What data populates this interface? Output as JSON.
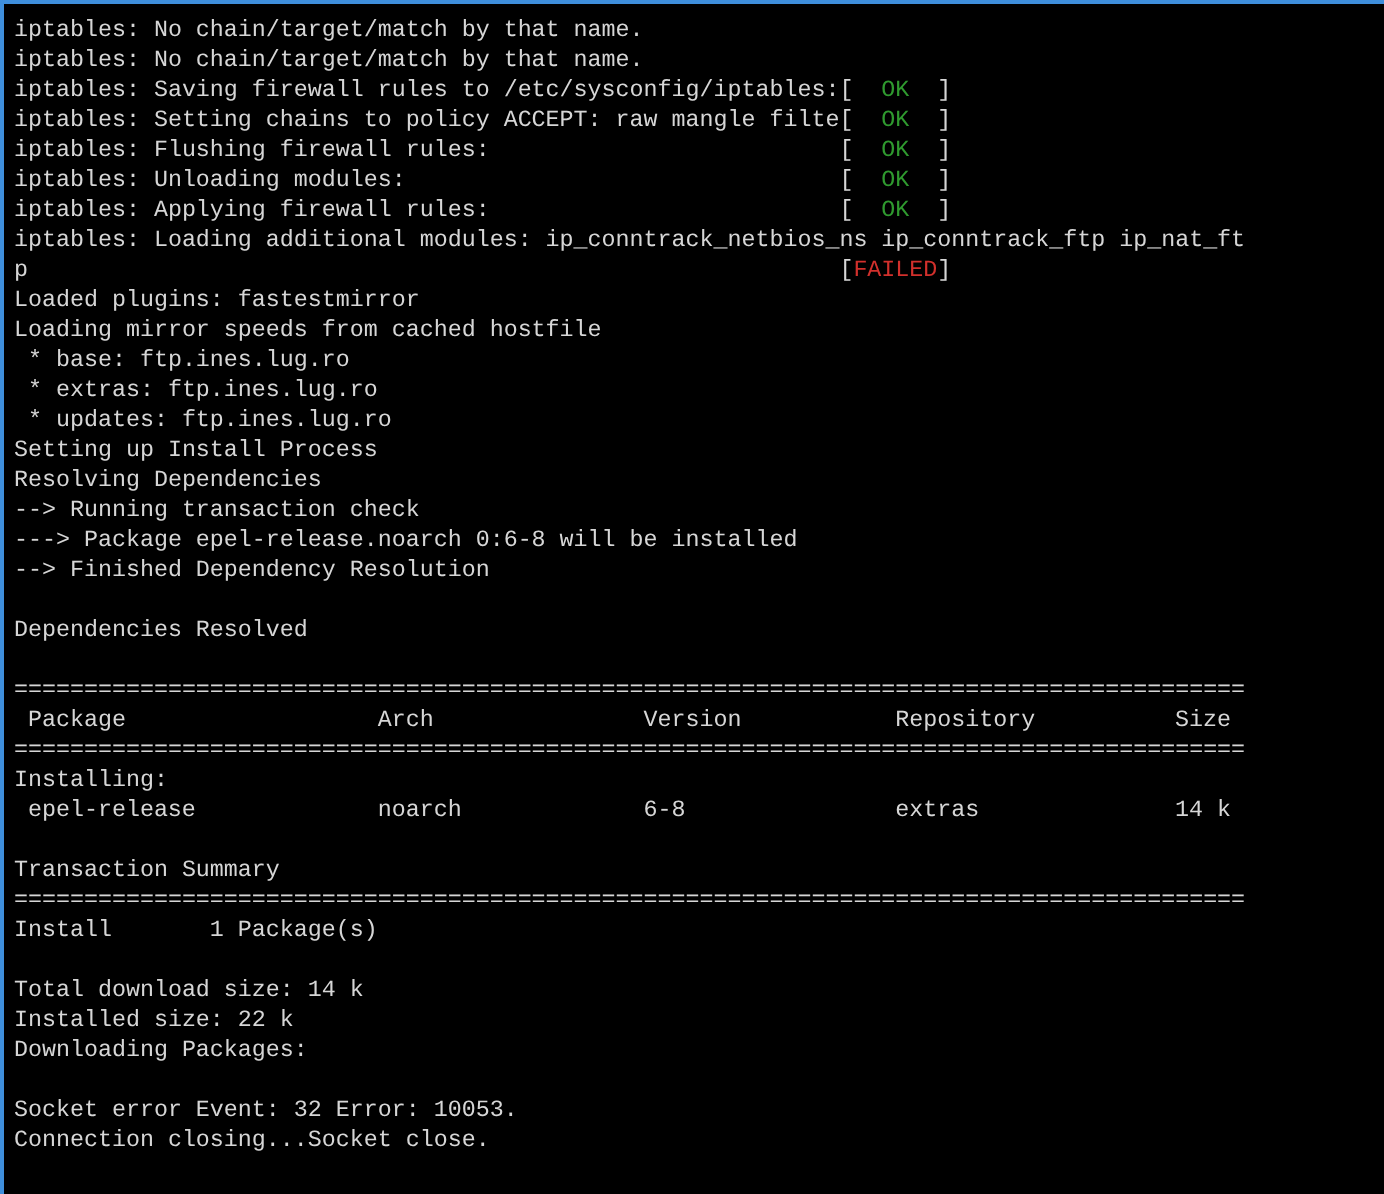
{
  "terminal": {
    "lines": [
      {
        "kind": "text",
        "text": "iptables: No chain/target/match by that name."
      },
      {
        "kind": "text",
        "text": "iptables: No chain/target/match by that name."
      },
      {
        "kind": "text",
        "text": "iptables: Saving firewall rules to /etc/sysconfig/iptables:",
        "status": {
          "open": "[",
          "label": "OK",
          "close": "]",
          "kind": "ok"
        }
      },
      {
        "kind": "text",
        "text": "iptables: Setting chains to policy ACCEPT: raw mangle filte",
        "status": {
          "open": "[",
          "label": "OK",
          "close": "]",
          "kind": "ok"
        }
      },
      {
        "kind": "text",
        "text": "iptables: Flushing firewall rules:",
        "status": {
          "open": "[",
          "label": "OK",
          "close": "]",
          "kind": "ok"
        }
      },
      {
        "kind": "text",
        "text": "iptables: Unloading modules:",
        "status": {
          "open": "[",
          "label": "OK",
          "close": "]",
          "kind": "ok"
        }
      },
      {
        "kind": "text",
        "text": "iptables: Applying firewall rules:",
        "status": {
          "open": "[",
          "label": "OK",
          "close": "]",
          "kind": "ok"
        }
      },
      {
        "kind": "text",
        "text": "iptables: Loading additional modules: ip_conntrack_netbios_ns ip_conntrack_ftp ip_nat_ft"
      },
      {
        "kind": "text",
        "text": "p",
        "status": {
          "open": "[",
          "label": "FAILED",
          "close": "]",
          "kind": "failed"
        }
      },
      {
        "kind": "text",
        "text": "Loaded plugins: fastestmirror"
      },
      {
        "kind": "text",
        "text": "Loading mirror speeds from cached hostfile"
      },
      {
        "kind": "text",
        "text": " * base: ftp.ines.lug.ro"
      },
      {
        "kind": "text",
        "text": " * extras: ftp.ines.lug.ro"
      },
      {
        "kind": "text",
        "text": " * updates: ftp.ines.lug.ro"
      },
      {
        "kind": "text",
        "text": "Setting up Install Process"
      },
      {
        "kind": "text",
        "text": "Resolving Dependencies"
      },
      {
        "kind": "text",
        "text": "--> Running transaction check"
      },
      {
        "kind": "text",
        "text": "---> Package epel-release.noarch 0:6-8 will be installed"
      },
      {
        "kind": "text",
        "text": "--> Finished Dependency Resolution"
      },
      {
        "kind": "blank"
      },
      {
        "kind": "text",
        "text": "Dependencies Resolved"
      },
      {
        "kind": "blank"
      },
      {
        "kind": "text",
        "text": "========================================================================================"
      },
      {
        "kind": "columns",
        "cells": [
          "Package",
          "Arch",
          "Version",
          "Repository",
          "Size"
        ]
      },
      {
        "kind": "text",
        "text": "========================================================================================"
      },
      {
        "kind": "text",
        "text": "Installing:"
      },
      {
        "kind": "columns",
        "cells": [
          "epel-release",
          "noarch",
          "6-8",
          "extras",
          "14 k"
        ]
      },
      {
        "kind": "blank"
      },
      {
        "kind": "text",
        "text": "Transaction Summary"
      },
      {
        "kind": "text",
        "text": "========================================================================================"
      },
      {
        "kind": "text",
        "text": "Install       1 Package(s)"
      },
      {
        "kind": "blank"
      },
      {
        "kind": "text",
        "text": "Total download size: 14 k"
      },
      {
        "kind": "text",
        "text": "Installed size: 22 k"
      },
      {
        "kind": "text",
        "text": "Downloading Packages:"
      },
      {
        "kind": "blank"
      },
      {
        "kind": "text",
        "text": "Socket error Event: 32 Error: 10053."
      },
      {
        "kind": "text",
        "text": "Connection closing...Socket close."
      }
    ]
  }
}
